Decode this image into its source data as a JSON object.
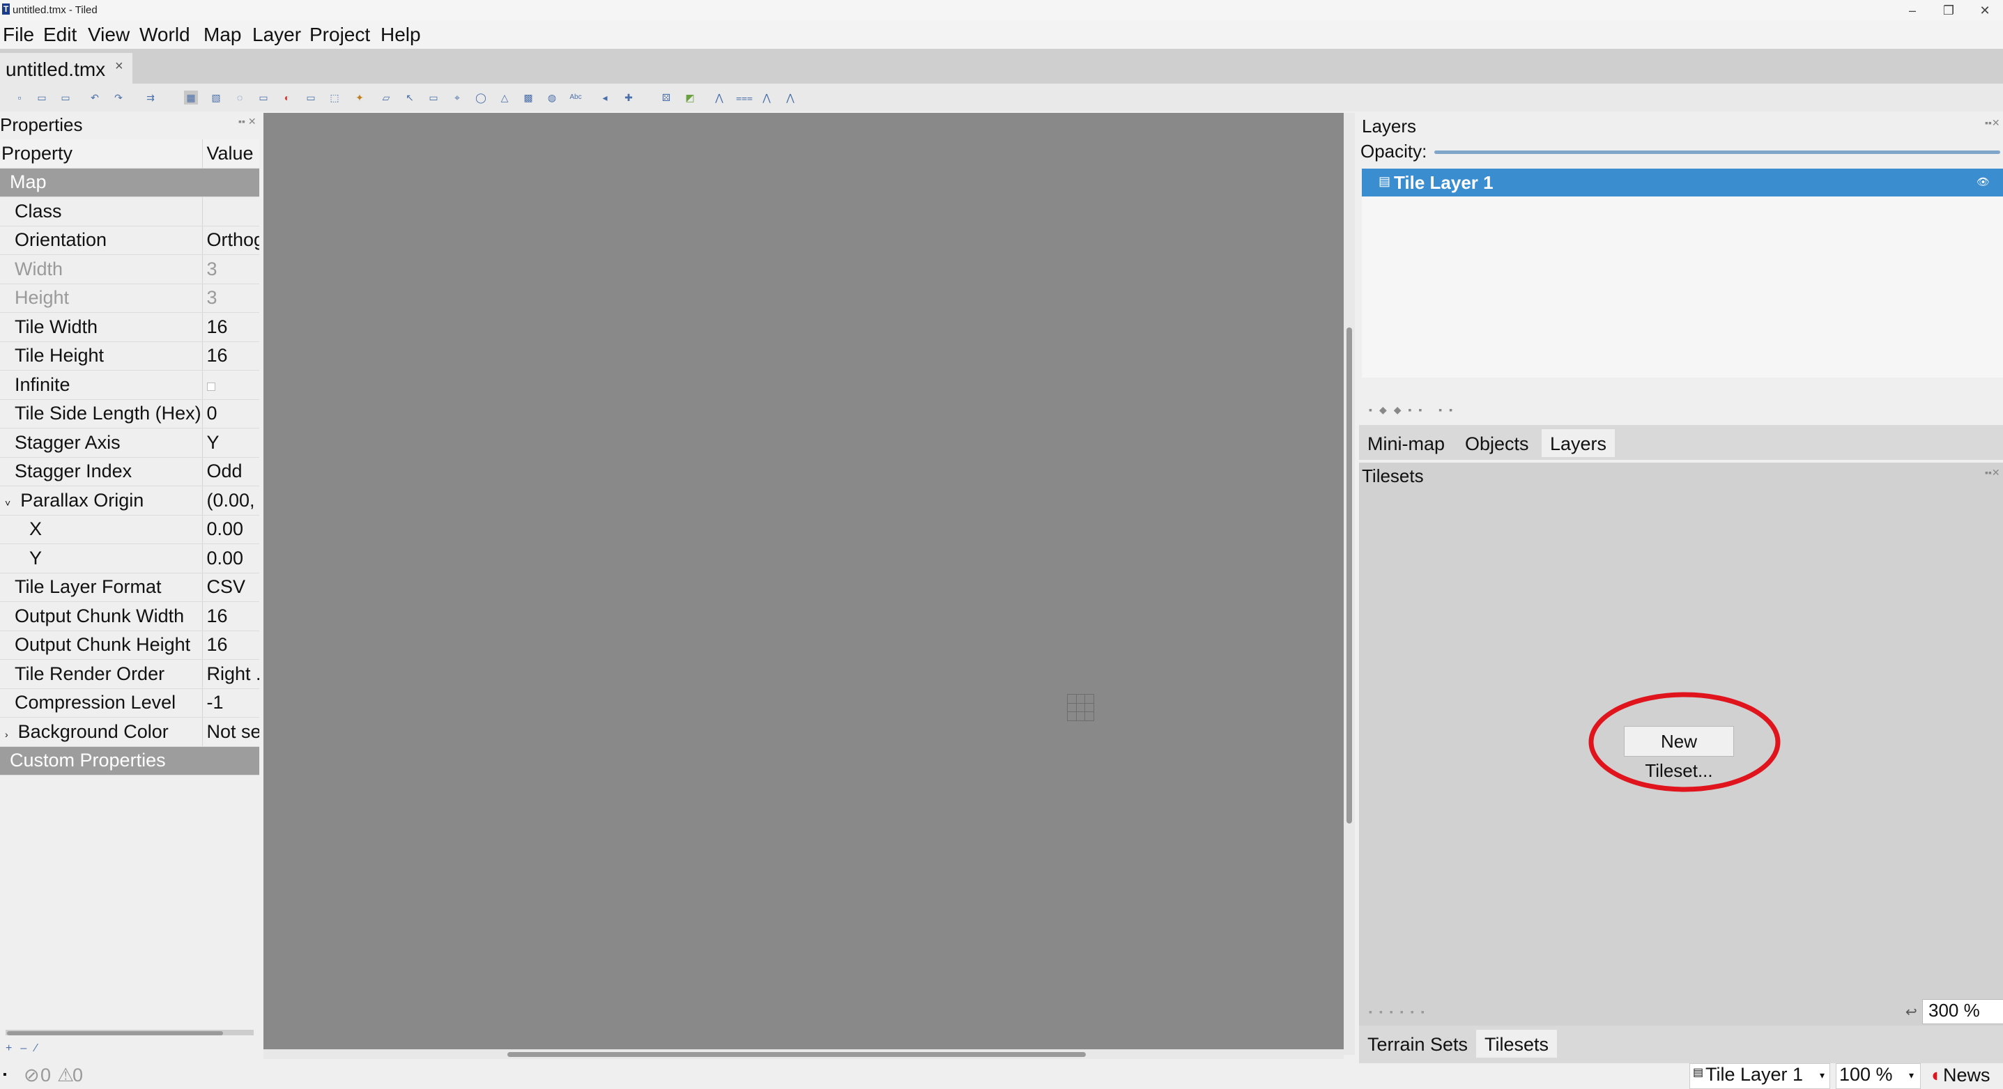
{
  "window": {
    "title": "untitled.tmx - Tiled"
  },
  "menu": [
    "File",
    "Edit",
    "View",
    "World",
    "Map",
    "Layer",
    "Project",
    "Help"
  ],
  "document_tab": {
    "label": "untitled.tmx",
    "close": "×"
  },
  "properties": {
    "title": "Properties",
    "col_property": "Property",
    "col_value": "Value",
    "group_map": "Map",
    "rows": [
      {
        "name": "Class",
        "value": ""
      },
      {
        "name": "Orientation",
        "value": "Orthog"
      },
      {
        "name": "Width",
        "value": "3"
      },
      {
        "name": "Height",
        "value": "3"
      },
      {
        "name": "Tile Width",
        "value": "16"
      },
      {
        "name": "Tile Height",
        "value": "16"
      },
      {
        "name": "Infinite",
        "value": ""
      },
      {
        "name": "Tile Side Length (Hex)",
        "value": "0"
      },
      {
        "name": "Stagger Axis",
        "value": "Y"
      },
      {
        "name": "Stagger Index",
        "value": "Odd"
      },
      {
        "name": "Parallax Origin",
        "value": "(0.00, ("
      },
      {
        "name": "X",
        "value": "0.00"
      },
      {
        "name": "Y",
        "value": "0.00"
      },
      {
        "name": "Tile Layer Format",
        "value": "CSV"
      },
      {
        "name": "Output Chunk Width",
        "value": "16"
      },
      {
        "name": "Output Chunk Height",
        "value": "16"
      },
      {
        "name": "Tile Render Order",
        "value": "Right ."
      },
      {
        "name": "Compression Level",
        "value": "-1"
      },
      {
        "name": "Background Color",
        "value": "Not se"
      }
    ],
    "group_custom": "Custom Properties"
  },
  "layers": {
    "title": "Layers",
    "opacity_label": "Opacity:",
    "opacity": 1.0,
    "items": [
      {
        "label": "Tile Layer 1"
      }
    ]
  },
  "middle_tabs": [
    "Mini-map",
    "Objects",
    "Layers"
  ],
  "tilesets": {
    "title": "Tilesets",
    "new_button": "New Tileset...",
    "zoom": "300 %"
  },
  "bottom_tabs": [
    "Terrain Sets",
    "Tilesets"
  ],
  "status": {
    "errors": "0",
    "warnings": "0",
    "layer": "Tile Layer 1",
    "zoom": "100 %",
    "news": "News"
  },
  "colors": {
    "accent": "#3a8ed0",
    "highlight_circle": "#e0141c",
    "canvas": "#898989"
  }
}
